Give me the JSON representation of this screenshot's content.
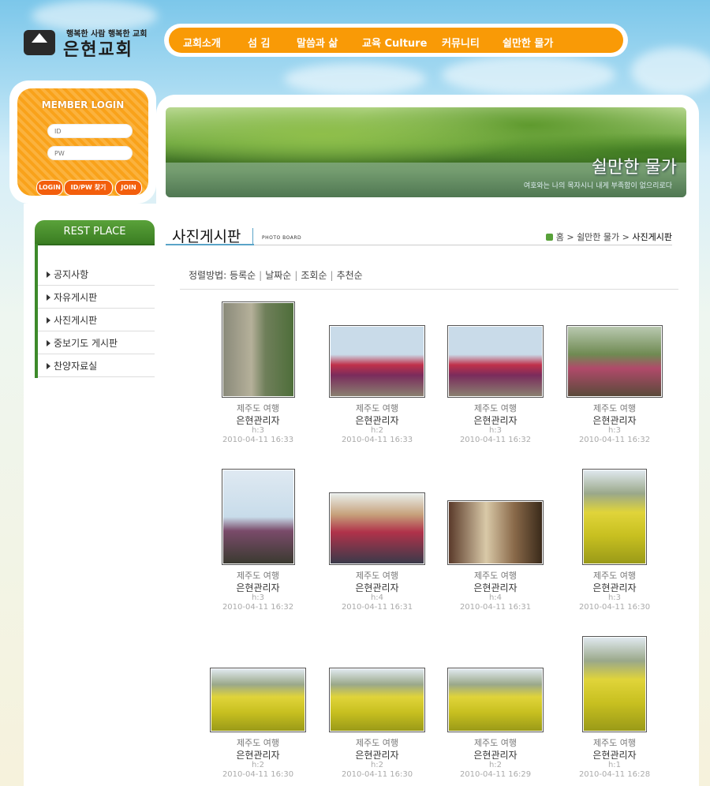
{
  "header": {
    "slogan": "행복한 사람 행복한 교회",
    "church_name": "은현교회"
  },
  "nav": [
    "교회소개",
    "섬 김",
    "말씀과 삶",
    "교육 Culture",
    "커뮤니티",
    "쉴만한 물가"
  ],
  "login": {
    "title": "MEMBER LOGIN",
    "id_placeholder": "ID",
    "pw_placeholder": "PW",
    "login_label": "LOGIN",
    "find_label": "ID/PW 찾기",
    "join_label": "JOIN"
  },
  "banner": {
    "title": "쉴만한 물가",
    "subtitle": "여호와는 나의 목자시니 내게 부족함이 없으리로다"
  },
  "sidebar": {
    "header": "REST PLACE",
    "items": [
      "공지사항",
      "자유게시판",
      "사진게시판",
      "중보기도 게시판",
      "찬양자료실"
    ]
  },
  "page": {
    "title": "사진게시판",
    "title_en": "PHOTO BOARD",
    "breadcrumb": [
      "홈",
      "쉴만한 물가",
      "사진게시판"
    ]
  },
  "sort": {
    "label": "정렬방법:",
    "options": [
      "등록순",
      "날짜순",
      "조회순",
      "추천순"
    ]
  },
  "photos": [
    {
      "subject": "제주도 여행",
      "author": "은현관리자",
      "hits": "h:3",
      "date": "2010-04-11 16:33",
      "scene": "cliff"
    },
    {
      "subject": "제주도 여행",
      "author": "은현관리자",
      "hits": "h:2",
      "date": "2010-04-11 16:33",
      "scene": "group"
    },
    {
      "subject": "제주도 여행",
      "author": "은현관리자",
      "hits": "h:3",
      "date": "2010-04-11 16:32",
      "scene": "group"
    },
    {
      "subject": "제주도 여행",
      "author": "은현관리자",
      "hits": "h:3",
      "date": "2010-04-11 16:32",
      "scene": "forest"
    },
    {
      "subject": "제주도 여행",
      "author": "은현관리자",
      "hits": "h:3",
      "date": "2010-04-11 16:32",
      "scene": "sea"
    },
    {
      "subject": "제주도 여행",
      "author": "은현관리자",
      "hits": "h:4",
      "date": "2010-04-11 16:31",
      "scene": "crowd"
    },
    {
      "subject": "제주도 여행",
      "author": "은현관리자",
      "hits": "h:4",
      "date": "2010-04-11 16:31",
      "scene": "room"
    },
    {
      "subject": "제주도 여행",
      "author": "은현관리자",
      "hits": "h:3",
      "date": "2010-04-11 16:30",
      "scene": "flowers"
    },
    {
      "subject": "제주도 여행",
      "author": "은현관리자",
      "hits": "h:2",
      "date": "2010-04-11 16:30",
      "scene": "flowers"
    },
    {
      "subject": "제주도 여행",
      "author": "은현관리자",
      "hits": "h:2",
      "date": "2010-04-11 16:30",
      "scene": "flowers"
    },
    {
      "subject": "제주도 여행",
      "author": "은현관리자",
      "hits": "h:2",
      "date": "2010-04-11 16:29",
      "scene": "flowers"
    },
    {
      "subject": "제주도 여행",
      "author": "은현관리자",
      "hits": "h:1",
      "date": "2010-04-11 16:28",
      "scene": "flowers"
    }
  ],
  "colors": {
    "nav_orange": "#f99a06",
    "sidebar_green": "#3a7d22",
    "accent_blue": "#5aa4c8"
  }
}
